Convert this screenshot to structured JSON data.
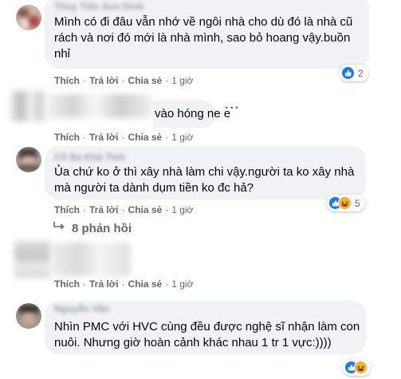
{
  "comments": [
    {
      "author": "Thùy Tiên Son Dinh",
      "text": "Mình có đi đâu vẫn nhớ về ngôi nhà cho dù đó là nhà cũ\nrách và nơi đó mới là nhà mình, sao bỏ hoang vậy.buồn\nnhỉ",
      "like": "Thích",
      "reply": "Trả lời",
      "share": "Chia sẻ",
      "time": "1 giờ",
      "reaction_count": "2",
      "reactions": [
        "like-icon"
      ]
    },
    {
      "author": "",
      "text": "vào hóng ne e",
      "like": "Thích",
      "reply": "Trả lời",
      "share": "Chia sẻ",
      "time": "1 giờ",
      "more": "···"
    },
    {
      "author": "Cô Ba Khả Tình",
      "text": "Ủa chứ ko ở thì xây nhà làm chi vậy.người ta ko xây nhà\nmà người ta dành dụm tiền ko đc hả?",
      "like": "Thích",
      "reply": "Trả lời",
      "share": "Chia sẻ",
      "time": "1 giờ",
      "reaction_count": "5",
      "reactions": [
        "like-icon",
        "haha-icon"
      ],
      "replies": "8 phản hồi"
    },
    {
      "author": "",
      "text": "",
      "like": "Thích",
      "reply": "Trả lời",
      "share": "Chia sẻ",
      "time": "1 giờ"
    },
    {
      "author": "Nguyễn Văn",
      "text": "Nhìn PMC với HVC cùng đều được nghệ sĩ nhận làm con\nnuôi. Nhưng giờ hoàn cảnh khác nhau 1 tr 1 vực:))))",
      "reaction_count": "",
      "reactions": [
        "like-icon",
        "haha-icon"
      ]
    }
  ],
  "colors": {
    "bubble_bg": "#f0f2f5",
    "meta_text": "#65676b",
    "like_blue": "#1877f2",
    "haha_yellow": "#f7b125"
  }
}
